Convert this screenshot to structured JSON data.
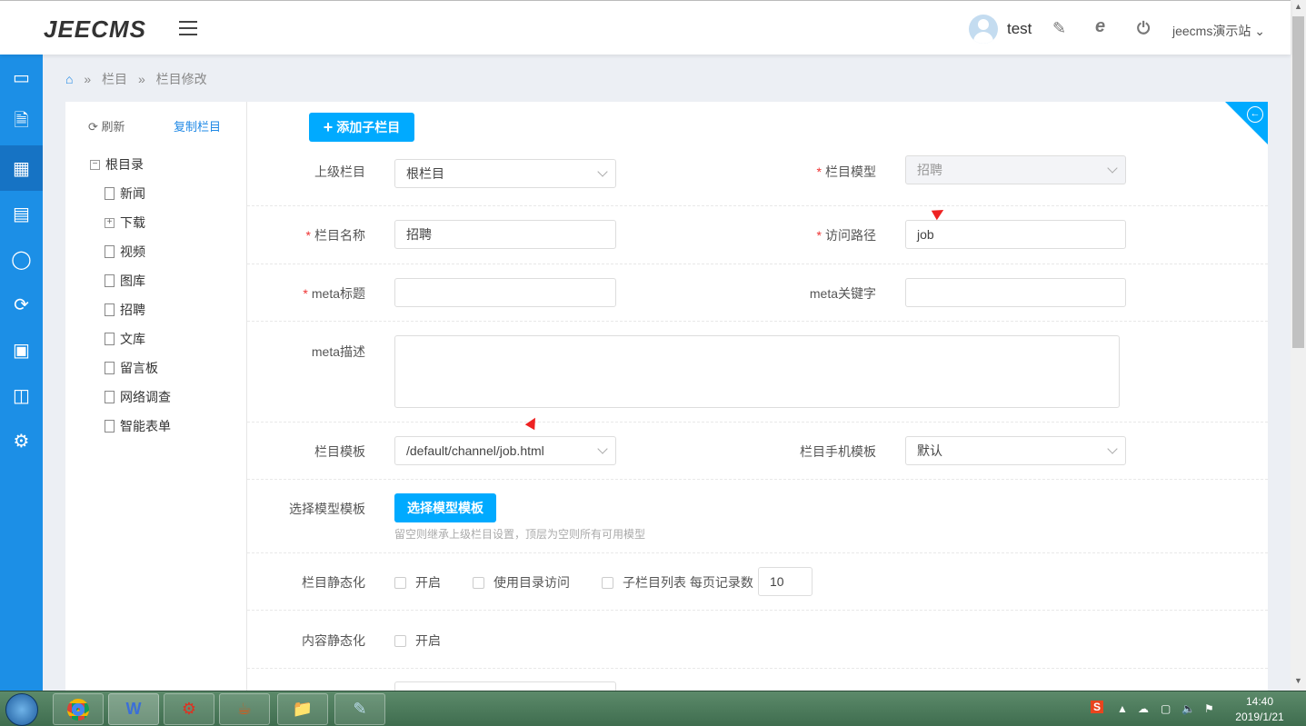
{
  "header": {
    "logo": "JEECMS",
    "user": "test",
    "site": "jeecms演示站",
    "icons": [
      "menu-icon",
      "user-edit-icon",
      "ie-icon",
      "power-icon",
      "chevron-down-icon"
    ]
  },
  "breadcrumb": [
    "栏目",
    "栏目修改"
  ],
  "tree": {
    "refresh": "刷新",
    "copy": "复制栏目",
    "root": "根目录",
    "items": [
      "新闻",
      "下载",
      "视频",
      "图库",
      "招聘",
      "文库",
      "留言板",
      "网络调查",
      "智能表单"
    ]
  },
  "form": {
    "add_child": "添加子栏目",
    "parent_label": "上级栏目",
    "parent_value": "根栏目",
    "model_label": "栏目模型",
    "model_value": "招聘",
    "name_label": "栏目名称",
    "name_value": "招聘",
    "path_label": "访问路径",
    "path_value": "job",
    "meta_title_label": "meta标题",
    "meta_title_value": "",
    "meta_keywords_label": "meta关键字",
    "meta_keywords_value": "",
    "meta_desc_label": "meta描述",
    "tpl_label": "栏目模板",
    "tpl_value": "/default/channel/job.html",
    "mobile_tpl_label": "栏目手机模板",
    "mobile_tpl_value": "默认",
    "model_tpl_label": "选择模型模板",
    "model_tpl_button": "选择模型模板",
    "model_tpl_hint": "留空则继承上级栏目设置，顶层为空则所有可用模型",
    "static_label": "栏目静态化",
    "static_on": "开启",
    "dir_access": "使用目录访问",
    "child_list": "子栏目列表 每页记录数",
    "page_size": "10",
    "content_static_label": "内容静态化",
    "content_static_on": "开启"
  },
  "taskbar": {
    "time": "14:40",
    "date": "2019/1/21"
  }
}
